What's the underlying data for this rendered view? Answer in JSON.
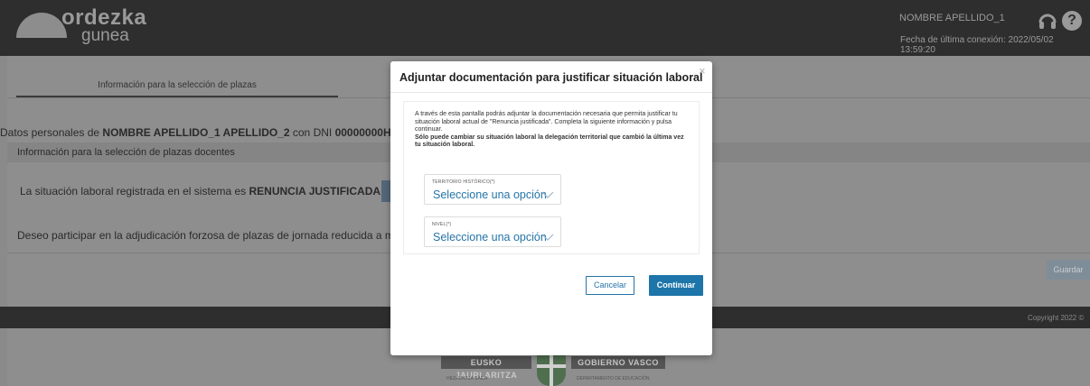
{
  "header": {
    "logo_title": "ordezka",
    "logo_subtitle": "gunea",
    "user_name": "NOMBRE APELLIDO_1",
    "last_connection": "Fecha de última conexión: 2022/05/02 13:59:20",
    "icons": {
      "user": "headset-icon",
      "help": "help-icon"
    },
    "help_glyph": "?"
  },
  "page": {
    "tab_label": "Información para la selección de plazas",
    "personal": {
      "prefix": "Datos personales de ",
      "name": "NOMBRE APELLIDO_1 APELLIDO_2",
      "middle": " con DNI ",
      "dni": "00000000H"
    },
    "section_title": "Información para la selección de plazas docentes",
    "situacion": {
      "prefix": "La situación laboral registrada en el sistema es ",
      "value": "RENUNCIA JUSTIFICADA"
    },
    "deseo": "Deseo participar en la adjudicación forzosa de plazas de jornada reducida a m",
    "guardar_label": "Guardar",
    "copyright": "Copyright 2022 ©"
  },
  "footer_logo": {
    "left": "EUSKO JAURLARITZA",
    "right": "GOBIERNO VASCO",
    "left_small": "HEZKUNTZA SAILA",
    "right_small": "DEPARTAMENTO DE EDUCACIÓN"
  },
  "modal": {
    "title": "Adjuntar documentación para justificar situación laboral",
    "close_glyph": "×",
    "intro": "A través de esta pantalla podrás adjuntar la documentación necesaria que permita justificar tu situación laboral actual de \"Renuncia justificada\". Completa la siguiente información y pulsa continuar.",
    "intro_bold": "Sólo puede cambiar su situación laboral la delegación territorial que cambió la última vez tu situación laboral.",
    "fields": [
      {
        "label": "TERRITORIO HISTÓRICO(*)",
        "value": "Seleccione una opción"
      },
      {
        "label": "NIVEL(*)",
        "value": "Seleccione una opción"
      }
    ],
    "cancel_label": "Cancelar",
    "continue_label": "Continuar"
  },
  "colors": {
    "accent": "#1d75a9",
    "overlay_header": "#2e2e2e",
    "page_dim": "#8e8e8e"
  }
}
